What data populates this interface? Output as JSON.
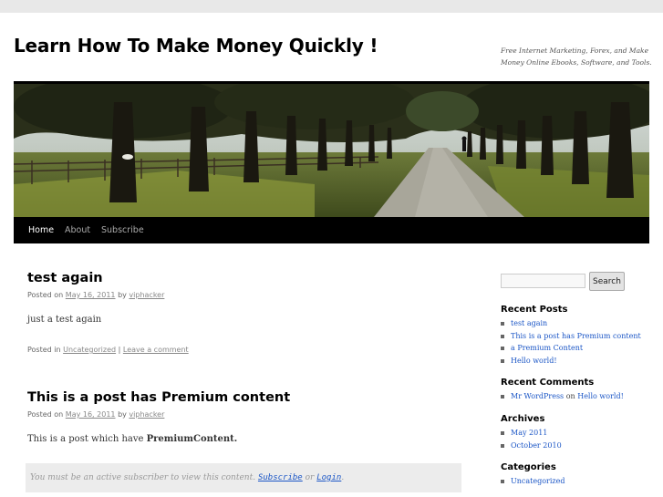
{
  "site": {
    "title": "Learn How To Make Money Quickly !",
    "description": "Free Internet Marketing, Forex, and Make Money Online Ebooks, Software, and Tools."
  },
  "nav": {
    "items": [
      {
        "label": "Home",
        "active": true
      },
      {
        "label": "About",
        "active": false
      },
      {
        "label": "Subscribe",
        "active": false
      }
    ]
  },
  "posts": [
    {
      "title": "test again",
      "posted_on": "Posted on",
      "date": "May 16, 2011",
      "by": "by",
      "author": "viphacker",
      "body": "just a test again",
      "posted_in": "Posted in",
      "category": "Uncategorized",
      "separator": "|",
      "comment_link": "Leave a comment"
    },
    {
      "title": "This is a post has Premium content",
      "posted_on": "Posted on",
      "date": "May 16, 2011",
      "by": "by",
      "author": "viphacker",
      "body_prefix": "This is a post which have",
      "body_bold": "PremiumContent.",
      "premium_notice": "You must be an active subscriber to view this content.",
      "subscribe_link": "Subscribe",
      "or": "or",
      "login_link": "Login",
      "period": "."
    }
  ],
  "sidebar": {
    "search": {
      "placeholder": "",
      "button_label": "Search"
    },
    "recent_posts": {
      "title": "Recent Posts",
      "items": [
        "test again",
        "This is a post has Premium content",
        "a Premium Content",
        "Hello world!"
      ]
    },
    "recent_comments": {
      "title": "Recent Comments",
      "author": "Mr WordPress",
      "on": "on",
      "post": "Hello world!"
    },
    "archives": {
      "title": "Archives",
      "items": [
        "May 2011",
        "October 2010"
      ]
    },
    "categories": {
      "title": "Categories",
      "items": [
        "Uncategorized"
      ]
    }
  },
  "colors": {
    "link": "#1b56c6",
    "nav_bg": "#000000",
    "premium_bg": "#ececec"
  }
}
